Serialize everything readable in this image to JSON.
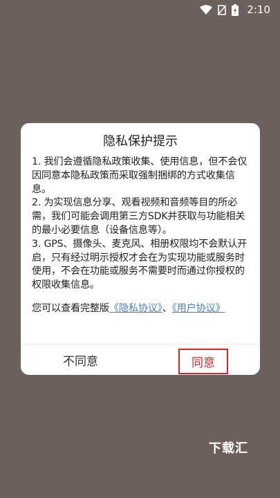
{
  "status_bar": {
    "time": "2:10",
    "icons": [
      "wifi-icon",
      "no-sim-icon",
      "battery-charging-icon"
    ]
  },
  "dialog": {
    "title": "隐私保护提示",
    "paragraphs": [
      "1. 我们会遵循隐私政策收集、使用信息，但不会仅因同意本隐私政策而采取强制捆绑的方式收集信息。",
      "2. 为实现信息分享、观看视频和音频等目的所必需，我们可能会调用第三方SDK并获取与功能相关的最小必要信息（设备信息等）。",
      "3. GPS、摄像头、麦克风、相册权限均不会默认开启，只有经过明示授权才会在为实现功能或服务时使用，不会在功能或服务不需要时而通过你授权的权限收集信息。"
    ],
    "link_prefix": "您可以查看完整版",
    "privacy_link": "《隐私协议》",
    "separator": "、",
    "user_link": "《用户协议》",
    "disagree_label": "不同意",
    "agree_label": "同意"
  },
  "watermark": "下载汇"
}
